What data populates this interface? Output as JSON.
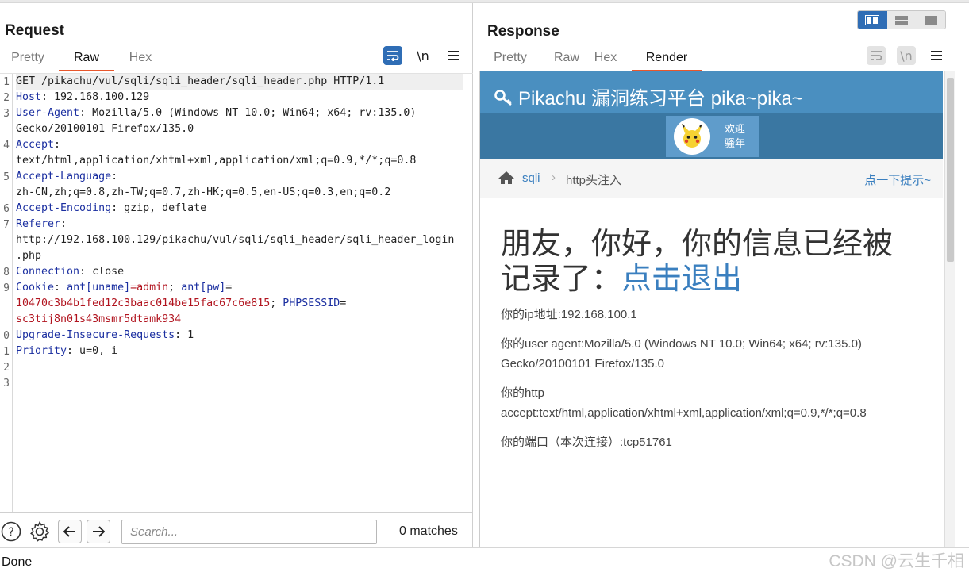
{
  "request": {
    "title": "Request",
    "tabs": [
      "Pretty",
      "Raw",
      "Hex"
    ],
    "active_tab": "Raw",
    "wrap_icon": "wrap-lines-icon",
    "newline_label": "\\n",
    "menu_icon": "hamburger-menu-icon",
    "line_numbers": [
      "1",
      "2",
      "3",
      "4",
      "5",
      "6",
      "7",
      "8",
      "9",
      "0",
      "1",
      "2",
      "3"
    ],
    "lines": {
      "l1": "GET /pikachu/vul/sqli/sqli_header/sqli_header.php HTTP/1.1",
      "l2k": "Host",
      "l2v": ": 192.168.100.129",
      "l3k": "User-Agent",
      "l3v": ": Mozilla/5.0 (Windows NT 10.0; Win64; x64; rv:135.0)",
      "l3c": "Gecko/20100101 Firefox/135.0",
      "l4k": "Accept",
      "l4v": ":",
      "l4c": "text/html,application/xhtml+xml,application/xml;q=0.9,*/*;q=0.8",
      "l5k": "Accept-Language",
      "l5v": ":",
      "l5c": "zh-CN,zh;q=0.8,zh-TW;q=0.7,zh-HK;q=0.5,en-US;q=0.3,en;q=0.2",
      "l6k": "Accept-Encoding",
      "l6v": ": gzip, deflate",
      "l7k": "Referer",
      "l7v": ":",
      "l7c": "http://192.168.100.129/pikachu/vul/sqli/sqli_header/sqli_header_login",
      "l7d": ".php",
      "l8k": "Connection",
      "l8v": ": close",
      "l9k": "Cookie",
      "l9a": ": ",
      "l9b": "ant[uname]",
      "l9c": "=admin",
      "l9d": "; ",
      "l9e": "ant[pw]",
      "l9f": "=",
      "l9g": "10470c3b4b1fed12c3baac014be15fac67c6e815",
      "l9h": "; ",
      "l9i": "PHPSESSID",
      "l9j": "=",
      "l9l": "sc3tij8n01s43msmr5dtamk934",
      "l10k": "Upgrade-Insecure-Requests",
      "l10v": ": 1",
      "l11k": "Priority",
      "l11v": ": u=0, i"
    },
    "search_placeholder": "Search...",
    "matches": "0 matches"
  },
  "response": {
    "title": "Response",
    "tabs": [
      "Pretty",
      "Raw",
      "Hex",
      "Render"
    ],
    "active_tab": "Render",
    "render": {
      "site_title": "Pikachu 漏洞练习平台 pika~pika~",
      "welcome_line1": "欢迎",
      "welcome_line2": "骚年",
      "breadcrumb_1": "sqli",
      "breadcrumb_2": "http头注入",
      "hint": "点一下提示~",
      "heading_a": "朋友，你好，你的信息已经被",
      "heading_b": "记录了：",
      "heading_link": "点击退出",
      "ip": "你的ip地址:192.168.100.1",
      "ua_1": "你的user agent:Mozilla/5.0 (Windows NT 10.0; Win64; x64; rv:135.0)",
      "ua_2": "Gecko/20100101 Firefox/135.0",
      "accept_1": "你的http",
      "accept_2": "accept:text/html,application/xhtml+xml,application/xml;q=0.9,*/*;q=0.8",
      "port": "你的端口（本次连接）:tcp51761"
    }
  },
  "status": {
    "text": "Done",
    "watermark": "CSDN @云生千相"
  },
  "colors": {
    "accent_orange": "#e8572c",
    "active_blue": "#2f6db5",
    "key_blue": "#1a2ea0",
    "value_red": "#b1131e",
    "pikachu_header": "#4a8fc0"
  }
}
